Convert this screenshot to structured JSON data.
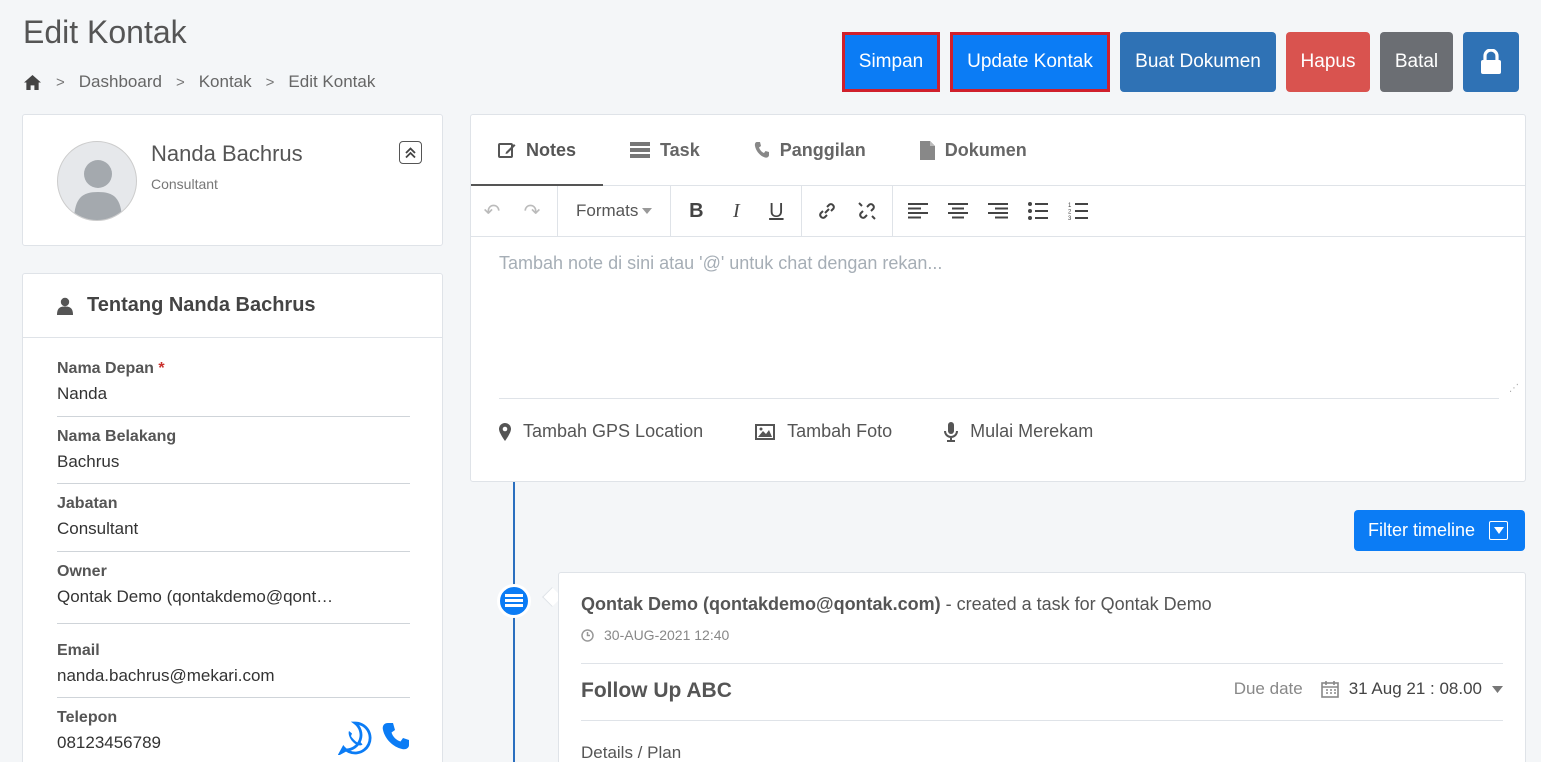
{
  "header": {
    "title": "Edit Kontak",
    "breadcrumb": [
      "Dashboard",
      "Kontak",
      "Edit Kontak"
    ]
  },
  "actions": {
    "save": "Simpan",
    "update": "Update Kontak",
    "create_doc": "Buat Dokumen",
    "delete": "Hapus",
    "cancel": "Batal"
  },
  "profile": {
    "name": "Nanda Bachrus",
    "role": "Consultant"
  },
  "about": {
    "title": "Tentang Nanda Bachrus",
    "fields": [
      {
        "label": "Nama Depan",
        "value": "Nanda",
        "required": "*"
      },
      {
        "label": "Nama Belakang",
        "value": "Bachrus"
      },
      {
        "label": "Jabatan",
        "value": "Consultant"
      },
      {
        "label": "Owner",
        "value": "Qontak Demo (qontakdemo@qont…"
      },
      {
        "label": "Email",
        "value": "nanda.bachrus@mekari.com"
      },
      {
        "label": "Telepon",
        "value": "08123456789"
      }
    ]
  },
  "tabs": [
    "Notes",
    "Task",
    "Panggilan",
    "Dokumen"
  ],
  "editor": {
    "formats_label": "Formats",
    "placeholder": "Tambah note di sini atau '@' untuk chat dengan rekan..."
  },
  "attachments": [
    "Tambah GPS Location",
    "Tambah Foto",
    "Mulai Merekam"
  ],
  "timeline": {
    "filter_label": "Filter timeline",
    "entry": {
      "author": "Qontak Demo (qontakdemo@qontak.com)",
      "action": " - created a task for Qontak Demo",
      "time": "30-AUG-2021 12:40",
      "task_title": "Follow Up ABC",
      "due_label": "Due date",
      "due_value": "31 Aug 21 : 08.00",
      "details_label": "Details / Plan"
    }
  },
  "colors": {
    "primary": "#0b7cf5",
    "dark_blue": "#2f72b5",
    "danger": "#d9534f",
    "gray": "#6b6e73",
    "highlight": "#d0202c"
  }
}
